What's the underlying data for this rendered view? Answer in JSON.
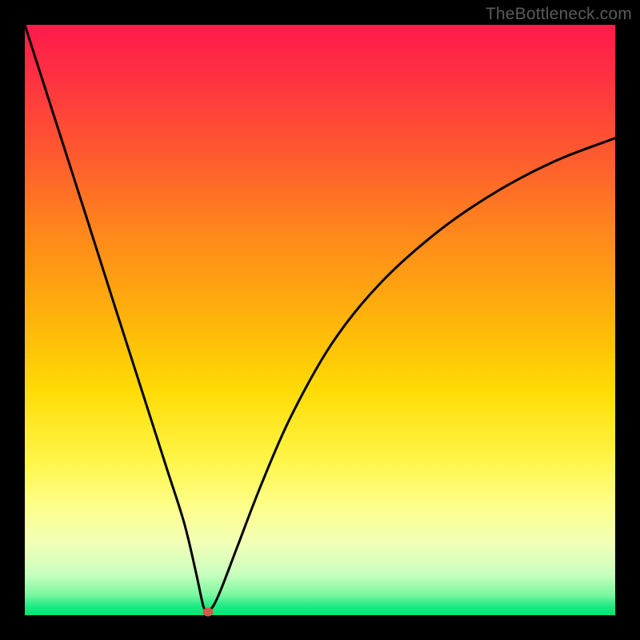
{
  "watermark": "TheBottleneck.com",
  "chart_data": {
    "type": "line",
    "title": "",
    "xlabel": "",
    "ylabel": "",
    "xlim": [
      0,
      1
    ],
    "ylim": [
      0,
      1
    ],
    "series": [
      {
        "name": "curve",
        "x": [
          0.0,
          0.05,
          0.1,
          0.15,
          0.2,
          0.24,
          0.27,
          0.29,
          0.3,
          0.305,
          0.315,
          0.33,
          0.36,
          0.4,
          0.45,
          0.52,
          0.6,
          0.7,
          0.8,
          0.9,
          1.0
        ],
        "y": [
          1.0,
          0.844,
          0.688,
          0.531,
          0.375,
          0.25,
          0.156,
          0.072,
          0.025,
          0.01,
          0.01,
          0.038,
          0.116,
          0.22,
          0.335,
          0.46,
          0.56,
          0.65,
          0.718,
          0.77,
          0.808
        ]
      }
    ],
    "marker": {
      "x": 0.31,
      "y": 0.006
    },
    "background_gradient": {
      "top": "#ff1a4b",
      "middle": "#ffdc05",
      "bottom": "#06e46f"
    }
  }
}
